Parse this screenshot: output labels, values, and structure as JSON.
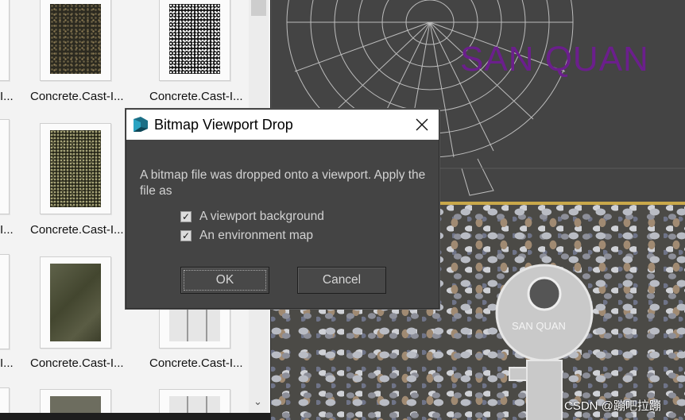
{
  "browser": {
    "captions": [
      {
        "text": "I..."
      },
      {
        "text": "Concrete.Cast-I..."
      },
      {
        "text": "Concrete.Cast-I..."
      },
      {
        "text": "I..."
      },
      {
        "text": "Concrete.Cast-I..."
      },
      {
        "text": "I..."
      },
      {
        "text": "Concrete.Cast-I..."
      },
      {
        "text": "Concrete.Cast-I..."
      }
    ],
    "scroll_down_icon": "chevron-down-icon"
  },
  "viewport_top": {
    "overlay_text": "SAN QUAN",
    "overlay_color": "#6b1f8c"
  },
  "viewport_bottom": {
    "key_text": "SAN QUAN"
  },
  "dialog": {
    "title": "Bitmap Viewport Drop",
    "close_icon": "close-icon",
    "message": "A bitmap file was dropped onto a viewport. Apply the file as",
    "options": [
      {
        "label": "A viewport background",
        "checked": true
      },
      {
        "label": "An environment map",
        "checked": true
      }
    ],
    "ok_label": "OK",
    "cancel_label": "Cancel"
  },
  "watermark": "CSDN @蹦吧拉蹦"
}
